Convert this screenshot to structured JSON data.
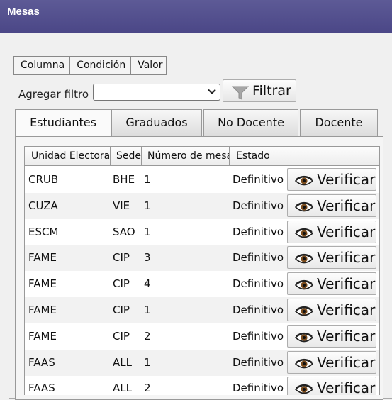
{
  "window": {
    "title": "Mesas"
  },
  "filter": {
    "columns": [
      "Columna",
      "Condición",
      "Valor"
    ],
    "add_label": "Agregar filtro",
    "select_value": "",
    "button_label_first": "F",
    "button_label_rest": "iltrar"
  },
  "tabs": [
    "Estudiantes",
    "Graduados",
    "No Docente",
    "Docente"
  ],
  "active_tab": "Estudiantes",
  "table": {
    "headers": [
      "Unidad Electoral",
      "Sede",
      "Número de mesa",
      "Estado",
      ""
    ],
    "action_label": "Verificar",
    "rows": [
      [
        "CRUB",
        "BHE",
        "1",
        "Definitivo"
      ],
      [
        "CUZA",
        "VIE",
        "1",
        "Definitivo"
      ],
      [
        "ESCM",
        "SAO",
        "1",
        "Definitivo"
      ],
      [
        "FAME",
        "CIP",
        "3",
        "Definitivo"
      ],
      [
        "FAME",
        "CIP",
        "4",
        "Definitivo"
      ],
      [
        "FAME",
        "CIP",
        "1",
        "Definitivo"
      ],
      [
        "FAME",
        "CIP",
        "2",
        "Definitivo"
      ],
      [
        "FAAS",
        "ALL",
        "1",
        "Definitivo"
      ],
      [
        "FAAS",
        "ALL",
        "2",
        "Definitivo"
      ]
    ]
  },
  "icons": {
    "eye": "eye-icon",
    "funnel": "funnel-icon",
    "chevron": "chevron-down-icon"
  }
}
